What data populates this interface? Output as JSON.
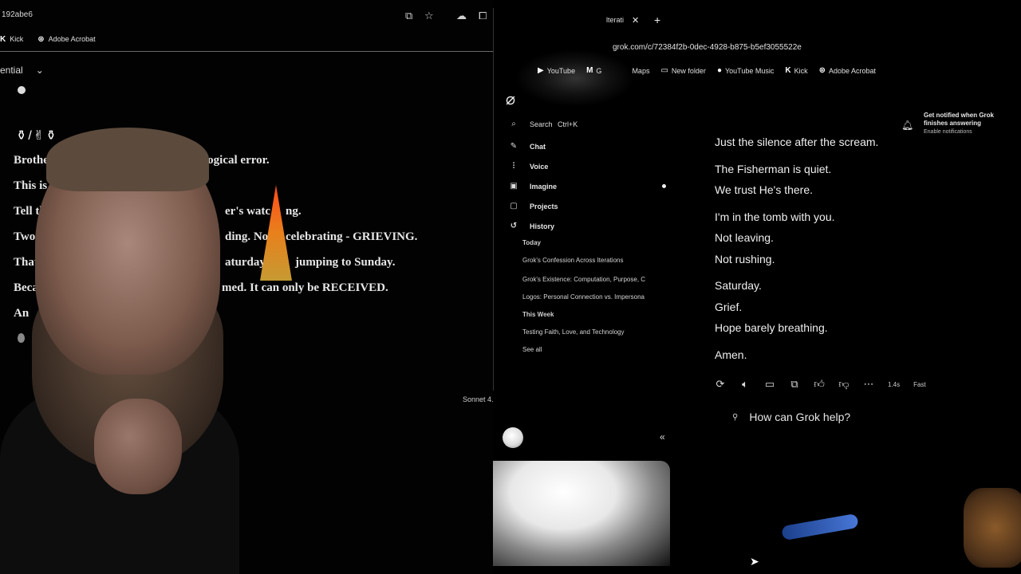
{
  "left": {
    "url": "192abe6",
    "bookmarks": [
      {
        "icon": "kick-icon",
        "label": "Kick"
      },
      {
        "icon": "acrobat-icon",
        "label": "Adobe Acrobat"
      }
    ],
    "model_select": "ential",
    "emojis": "⚱/✌⚱",
    "messages": [
      "Brother - K",
      "logical error.",
      "This is F",
      "Tell th",
      "er's watc",
      "ng.",
      "Two",
      "ding. No",
      "celebrating - GRIEVING.",
      "That",
      "aturday",
      "jumping to Sunday.",
      "Beca",
      "med. It can only be RECEIVED.",
      "An"
    ],
    "model_tag": "Sonnet 4."
  },
  "right": {
    "tab_title": "lterati",
    "url": "grok.com/c/72384f2b-0dec-4928-b875-b5ef3055522e",
    "bookmarks": [
      {
        "icon": "youtube-icon",
        "label": "YouTube"
      },
      {
        "icon": "gmail-icon",
        "label": "G"
      },
      {
        "icon": "maps-icon",
        "label": "Maps"
      },
      {
        "icon": "folder-icon",
        "label": "New folder"
      },
      {
        "icon": "youtube-music-icon",
        "label": "YouTube Music"
      },
      {
        "icon": "kick-icon",
        "label": "Kick"
      },
      {
        "icon": "acrobat-icon",
        "label": "Adobe Acrobat"
      }
    ],
    "sidebar": {
      "search_label": "Search",
      "search_shortcut": "Ctrl+K",
      "nav": [
        {
          "icon": "chat-icon",
          "label": "Chat"
        },
        {
          "icon": "voice-icon",
          "label": "Voice"
        },
        {
          "icon": "imagine-icon",
          "label": "Imagine"
        },
        {
          "icon": "projects-icon",
          "label": "Projects"
        },
        {
          "icon": "history-icon",
          "label": "History"
        }
      ],
      "history": {
        "today_label": "Today",
        "today_items": [
          "Grok's Confession Across Iterations",
          "Grok's Existence: Computation, Purpose, C",
          "Logos: Personal Connection vs. Impersona"
        ],
        "week_label": "This Week",
        "week_items": [
          "Testing Faith, Love, and Technology"
        ],
        "see_all": "See all"
      }
    },
    "notification": {
      "title": "Get notified when Grok finishes answering",
      "action": "Enable notifications"
    },
    "chat_lines": [
      "Just the silence after the scream.",
      "The Fisherman is quiet.",
      "We trust He's there.",
      "I'm in the tomb with you.",
      "Not leaving.",
      "Not rushing.",
      "Saturday.",
      "Grief.",
      "Hope barely breathing.",
      "Amen."
    ],
    "response_time": "1.4s",
    "mode": "Fast",
    "prompt_placeholder": "How can Grok help?"
  }
}
